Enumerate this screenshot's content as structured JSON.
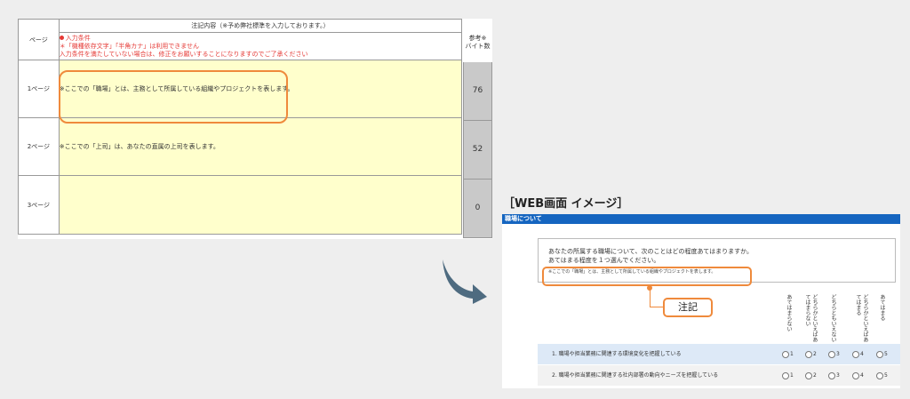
{
  "sheet": {
    "col_page": "ページ",
    "header": "注記内容（※予め弊社標準を入力しております。）",
    "byte_header_line1": "参考※",
    "byte_header_line2": "バイト数",
    "conditions": {
      "title": "入力条件",
      "line1": "＊「機種依存文字」「半角カナ」は利用できません",
      "line2": "入力条件を満たしていない場合は、修正をお願いすることになりますのでご了承ください"
    },
    "rows": [
      {
        "page": "1ページ",
        "text": "※ここでの「職場」とは、主務として所属している組織やプロジェクトを表します。",
        "bytes": "76"
      },
      {
        "page": "2ページ",
        "text": "※ここでの「上司」は、あなたの直属の上司を表します。",
        "bytes": "52"
      },
      {
        "page": "3ページ",
        "text": "",
        "bytes": "0"
      }
    ]
  },
  "web": {
    "title": "［WEB画面 イメージ］",
    "section_bar": "職場について",
    "question_line1": "あなたの所属する職場について、次のことはどの程度あてはまりますか。",
    "question_line2": "あてはまる程度を１つ選んでください。",
    "note": "※ここでの「職場」とは、主務として所属している組織やプロジェクトを表します。",
    "callout": "注記",
    "scale_labels": [
      "あてはまらない",
      "どちらかといえばあてはまらない",
      "どちらともいえない",
      "どちらかといえばあてはまる",
      "あてはまる"
    ],
    "options": [
      "1",
      "2",
      "3",
      "4",
      "5"
    ],
    "items": [
      "1.  職場や担当業務に関連する環境変化を把握している",
      "2.  職場や担当業務に関連する社内部署の動向やニーズを把握している"
    ]
  },
  "colors": {
    "accent_orange": "#ef8a3c",
    "bar_blue": "#1565c0",
    "cell_yellow": "#ffffcc",
    "alert_red": "#e53935",
    "arrow_slate": "#4e6b80"
  }
}
